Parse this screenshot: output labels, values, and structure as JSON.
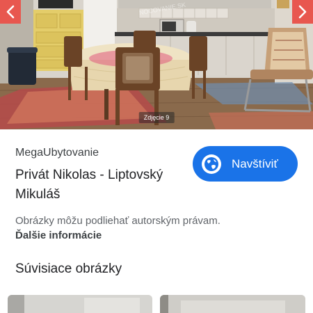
{
  "viewer": {
    "caption": "Zdjęcie 9",
    "prev_icon": "chevron-left-icon",
    "next_icon": "chevron-right-icon",
    "nav_color": "#e8574f"
  },
  "info": {
    "source": "MegaUbytovanie",
    "title": "Privát Nikolas - Liptovský Mikuláš",
    "visit_label": "Navštíviť",
    "visit_icon": "globe-icon",
    "copyright_notice": "Obrázky môžu podliehať autorským právam.",
    "more_info": "Ďalšie informácie"
  },
  "related": {
    "heading": "Súvisiace obrázky"
  },
  "colors": {
    "accent": "#1a73e8"
  }
}
